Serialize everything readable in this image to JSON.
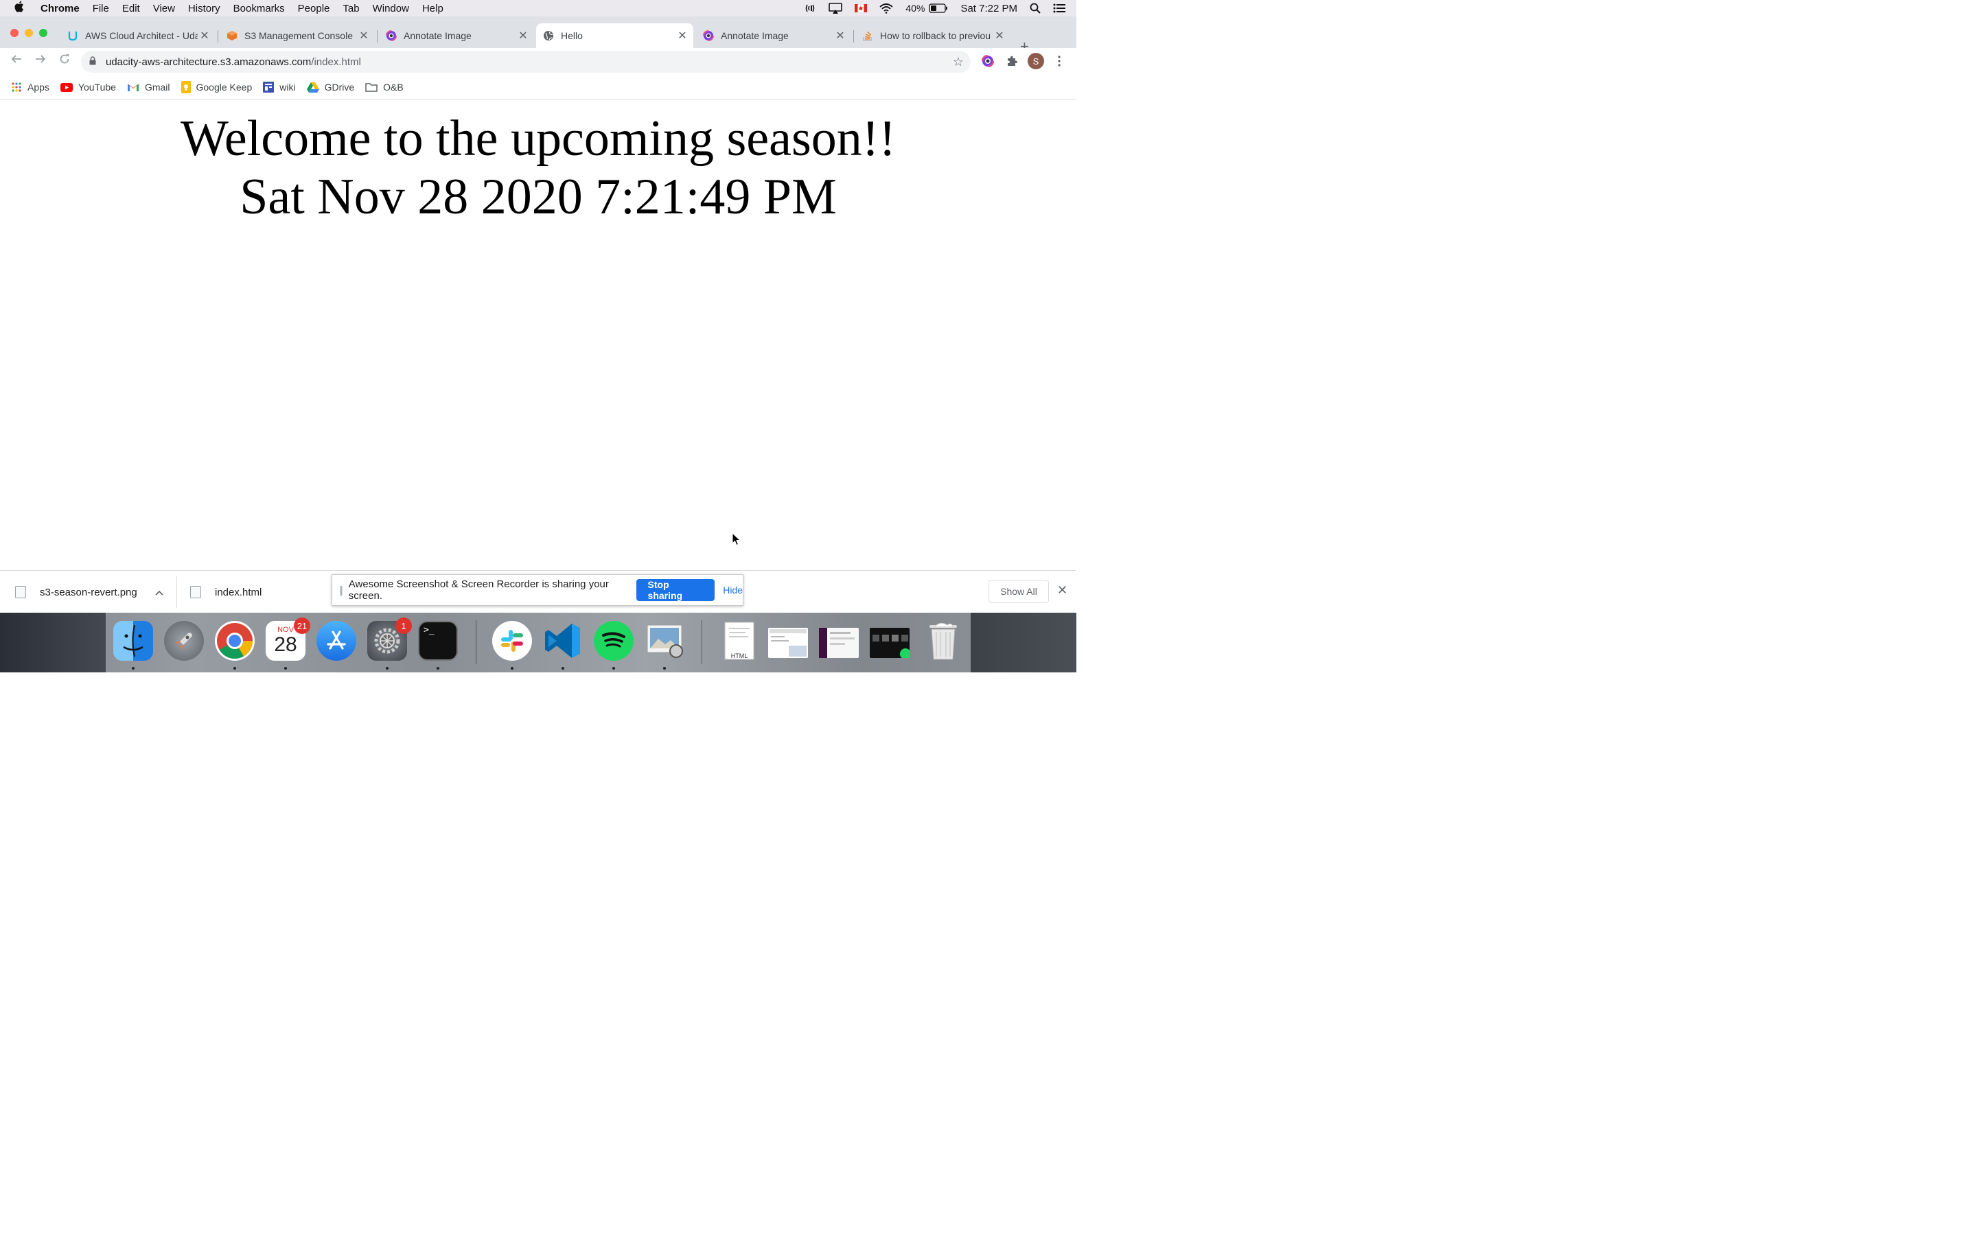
{
  "menubar": {
    "app": "Chrome",
    "items": [
      "File",
      "Edit",
      "View",
      "History",
      "Bookmarks",
      "People",
      "Tab",
      "Window",
      "Help"
    ],
    "battery": "40%",
    "clock": "Sat 7:22 PM"
  },
  "tabs": [
    {
      "title": "AWS Cloud Architect - Uda",
      "icon": "udacity-icon"
    },
    {
      "title": "S3 Management Console",
      "icon": "aws-s3-icon"
    },
    {
      "title": "Annotate Image",
      "icon": "annotate-icon"
    },
    {
      "title": "Hello",
      "icon": "globe-icon",
      "active": true
    },
    {
      "title": "Annotate Image",
      "icon": "annotate-icon"
    },
    {
      "title": "How to rollback to previou",
      "icon": "stackoverflow-icon"
    }
  ],
  "address": {
    "host": "udacity-aws-architecture.s3.amazonaws.com",
    "path": "/index.html"
  },
  "profile_initial": "S",
  "bookmarks": [
    {
      "label": "Apps",
      "icon": "apps-grid-icon"
    },
    {
      "label": "YouTube",
      "icon": "youtube-icon"
    },
    {
      "label": "Gmail",
      "icon": "gmail-icon"
    },
    {
      "label": "Google Keep",
      "icon": "keep-icon"
    },
    {
      "label": "wiki",
      "icon": "wiki-icon"
    },
    {
      "label": "GDrive",
      "icon": "drive-icon"
    },
    {
      "label": "O&B",
      "icon": "folder-icon"
    }
  ],
  "page": {
    "heading": "Welcome to the upcoming season!!",
    "datetime": "Sat Nov 28 2020 7:21:49 PM"
  },
  "downloads": {
    "items": [
      "s3-season-revert.png",
      "index.html"
    ],
    "show_all": "Show All"
  },
  "sharing": {
    "message": "Awesome Screenshot & Screen Recorder is sharing your screen.",
    "stop": "Stop sharing",
    "hide": "Hide"
  },
  "dock": {
    "calendar_month": "NOV",
    "calendar_day": "28",
    "calendar_badge": "21",
    "settings_badge": "1",
    "html_doc_label": "HTML"
  },
  "colors": {
    "accent": "#1a73e8",
    "tabstrip": "#dee1e6",
    "menubar": "#ece9ee"
  }
}
